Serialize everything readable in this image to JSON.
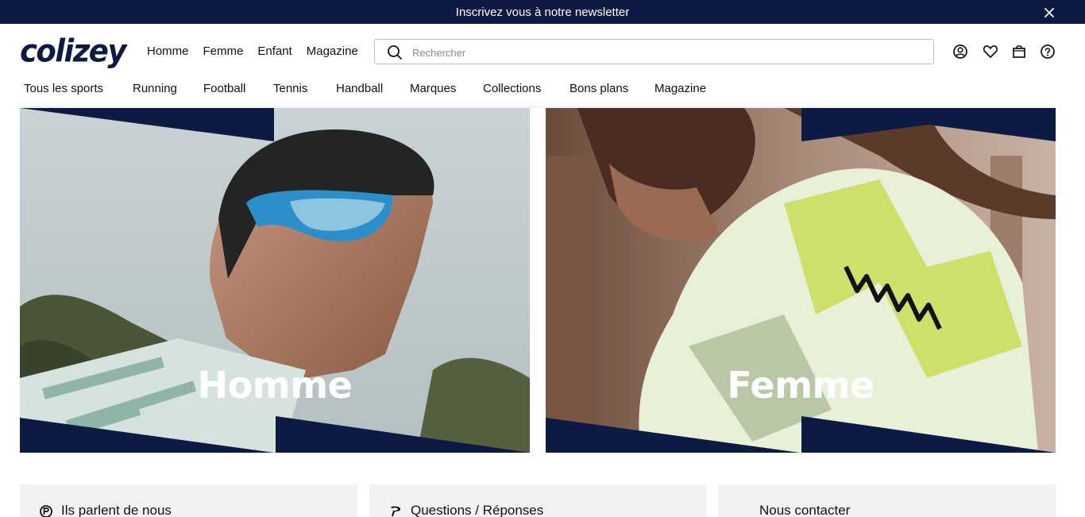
{
  "banner": {
    "text": "Inscrivez vous à notre newsletter",
    "close_icon": "close-icon"
  },
  "brand": {
    "logo": "colizey",
    "color": "#0c1a44"
  },
  "main_nav": [
    "Homme",
    "Femme",
    "Enfant",
    "Magazine"
  ],
  "search": {
    "placeholder": "Rechercher",
    "value": "",
    "icon": "search-icon"
  },
  "header_icons": [
    "account-icon",
    "heart-icon",
    "bag-icon",
    "help-icon"
  ],
  "category_nav": [
    "Tous les sports",
    "Running",
    "Football",
    "Tennis",
    "Handball",
    "Marques",
    "Collections",
    "Bons plans",
    "Magazine"
  ],
  "heroes": [
    {
      "title": "Homme"
    },
    {
      "title": "Femme"
    }
  ],
  "cards": [
    {
      "label": "Ils parlent de nous",
      "icon": "press-icon"
    },
    {
      "label": "Questions / Réponses",
      "icon": "question-icon"
    },
    {
      "label": "Nous contacter"
    }
  ],
  "colors": {
    "navy": "#0c1a44",
    "card_bg": "#f2f2f2"
  }
}
